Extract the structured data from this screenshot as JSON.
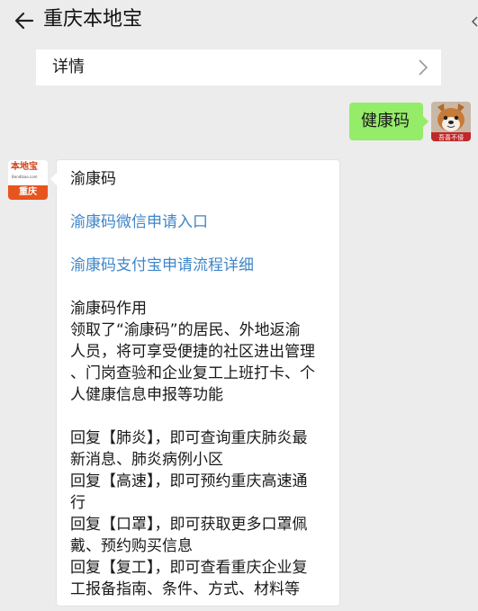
{
  "header": {
    "title": "重庆本地宝",
    "back_icon": "arrow-left-icon"
  },
  "detail_bar": {
    "label": "详情",
    "chevron_icon": "chevron-right-icon"
  },
  "sent_message": {
    "text": "健康码"
  },
  "user_avatar": {
    "caption": "吾喜不侵"
  },
  "bot_avatar": {
    "logo_text": "本地宝",
    "logo_url": "Bendibao.com",
    "city": "重庆"
  },
  "received_message": {
    "heading": "渝康码",
    "link_wechat": "渝康码微信申请入口",
    "link_alipay": "渝康码支付宝申请流程详细",
    "usage_title": "渝康码作用",
    "usage_lines": [
      "领取了“渝康码”的居民、外地返渝",
      "人员，将可享受便捷的社区进出管理",
      "、门岗查验和企业复工上班打卡、个",
      "人健康信息申报等功能"
    ],
    "reply_lines": [
      "回复【肺炎】，即可查询重庆肺炎最",
      "新消息、肺炎病例小区",
      "回复【高速】，即可预约重庆高速通",
      "行",
      "回复【口罩】，即可获取更多口罩佩",
      "戴、预约购买信息",
      "回复【复工】，即可查看重庆企业复",
      "工报备指南、条件、方式、材料等"
    ]
  },
  "colors": {
    "background": "#ececec",
    "sent_bubble": "#95ec69",
    "link": "#3f86c9"
  }
}
